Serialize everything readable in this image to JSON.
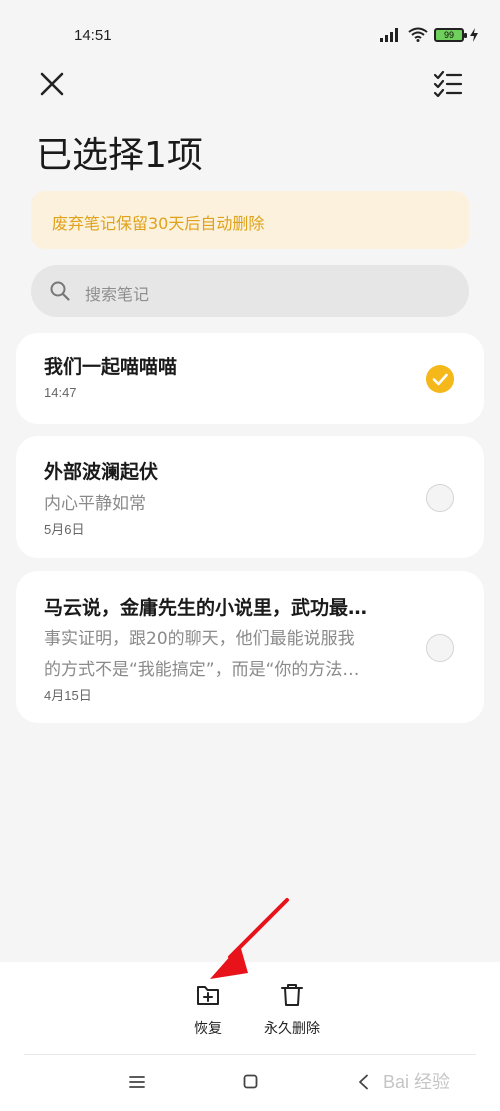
{
  "status_bar": {
    "time": "14:51",
    "battery": "99"
  },
  "page": {
    "title": "已选择1项"
  },
  "notice": {
    "text": "废弃笔记保留30天后自动删除"
  },
  "search": {
    "placeholder": "搜索笔记"
  },
  "notes": [
    {
      "title": "我们一起喵喵喵",
      "snippet_lines": [],
      "date": "14:47",
      "selected": true
    },
    {
      "title": "外部波澜起伏",
      "snippet_lines": [
        "内心平静如常"
      ],
      "date": "5月6日",
      "selected": false
    },
    {
      "title": "马云说，金庸先生的小说里，武功最…",
      "snippet_lines": [
        "事实证明，跟20的聊天，他们最能说服我",
        "的方式不是“我能搞定”，而是“你的方法…"
      ],
      "date": "4月15日",
      "selected": false
    }
  ],
  "actions": {
    "restore_label": "恢复",
    "delete_forever_label": "永久删除"
  },
  "watermark": {
    "text": "Bai 经验"
  },
  "colors": {
    "accent": "#f5b81b",
    "notice_text": "#e0a21a",
    "notice_bg": "#fbf1dd",
    "annotation_arrow": "#e8121b"
  }
}
